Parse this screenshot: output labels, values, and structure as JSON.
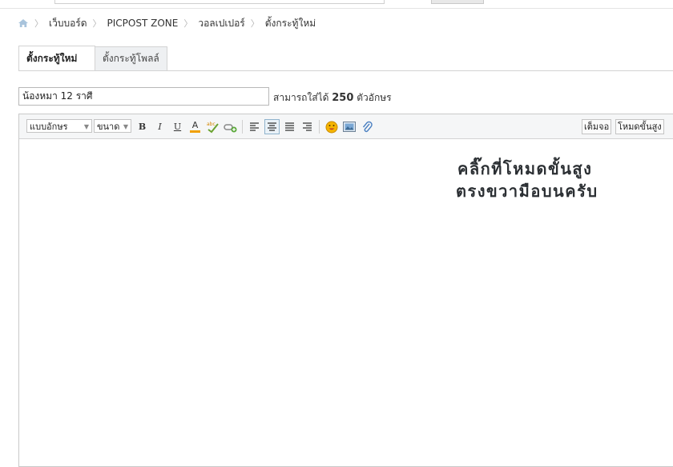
{
  "breadcrumb": {
    "items": [
      "เว็บบอร์ด",
      "PICPOST ZONE",
      "วอลเปเปอร์",
      "ตั้งกระทู้ใหม่"
    ]
  },
  "tabs": [
    {
      "label": "ตั้งกระทู้ใหม่",
      "active": true
    },
    {
      "label": "ตั้งกระทู้โพลล์",
      "active": false
    }
  ],
  "title_field": {
    "value": "น้องหมา 12 ราศี"
  },
  "char_hint": {
    "prefix": "สามารถใส่ได้",
    "count": "250",
    "suffix": "ตัวอักษร"
  },
  "toolbar": {
    "font_select": "แบบอักษร",
    "size_select": "ขนาด",
    "bold": "B",
    "italic": "I",
    "underline": "U",
    "font_color": "A",
    "fullscreen_label": "เต็มจอ",
    "advanced_label": "โหมดขั้นสูง"
  },
  "editor": {
    "note_line1": "คลิ๊กที่โหมดขั้นสูง",
    "note_line2": "ตรงขวามือบนครับ"
  },
  "colors": {
    "accent": "#8fb3cc",
    "border": "#c9c9c9",
    "toolbar_bg": "#f5f6f7"
  }
}
